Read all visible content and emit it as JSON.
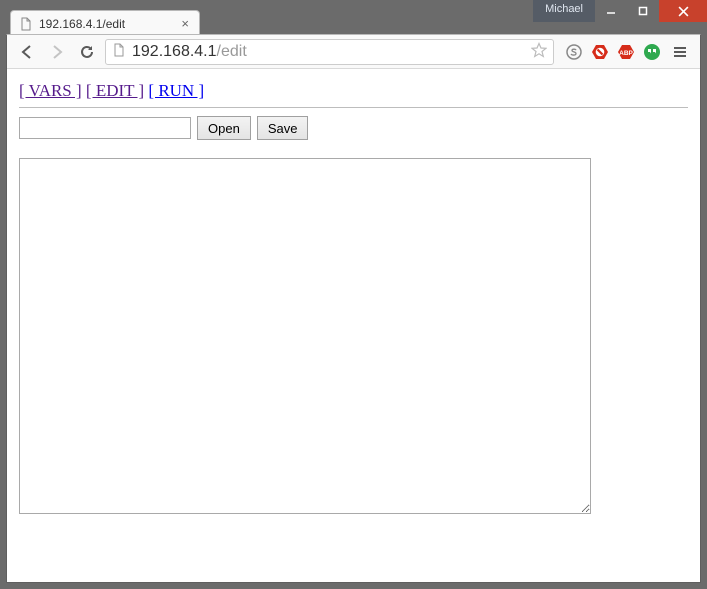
{
  "window": {
    "user_name": "Michael"
  },
  "tab": {
    "title": "192.168.4.1/edit"
  },
  "url": {
    "host": "192.168.4.1",
    "path": "/edit"
  },
  "nav": {
    "vars_label": "[ VARS ]",
    "edit_label": "[ EDIT ]",
    "run_label": "[ RUN ]"
  },
  "file": {
    "input_value": "",
    "open_label": "Open",
    "save_label": "Save"
  },
  "editor": {
    "content": ""
  }
}
